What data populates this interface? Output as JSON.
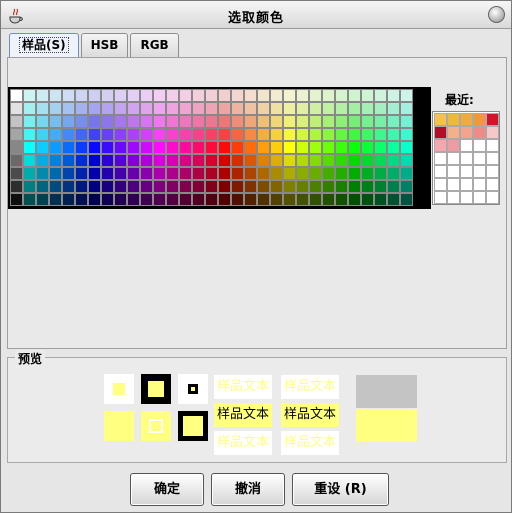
{
  "window": {
    "title": "选取颜色"
  },
  "tabs": [
    {
      "label": "样品(S)",
      "active": true
    },
    {
      "label": "HSB",
      "active": false
    },
    {
      "label": "RGB",
      "active": false
    }
  ],
  "swatches": {
    "recent_label": "最近:"
  },
  "preview": {
    "legend": "预览",
    "sample_text": "样品文本",
    "selected_color": "#ffff80"
  },
  "buttons": {
    "ok": "确定",
    "cancel": "撤消",
    "reset": "重设 (R)"
  },
  "recent_colors": [
    "#f6c04a",
    "#f0b73e",
    "#f1a845",
    "#f3963d",
    "#d2142a",
    "#b40d28",
    "#f4b08c",
    "#f5a38c",
    "#ef8a86",
    "#f7c8c8",
    "#f7a6ae",
    "#f29aa1",
    "#ffffff",
    "#ffffff",
    "#ffffff"
  ]
}
